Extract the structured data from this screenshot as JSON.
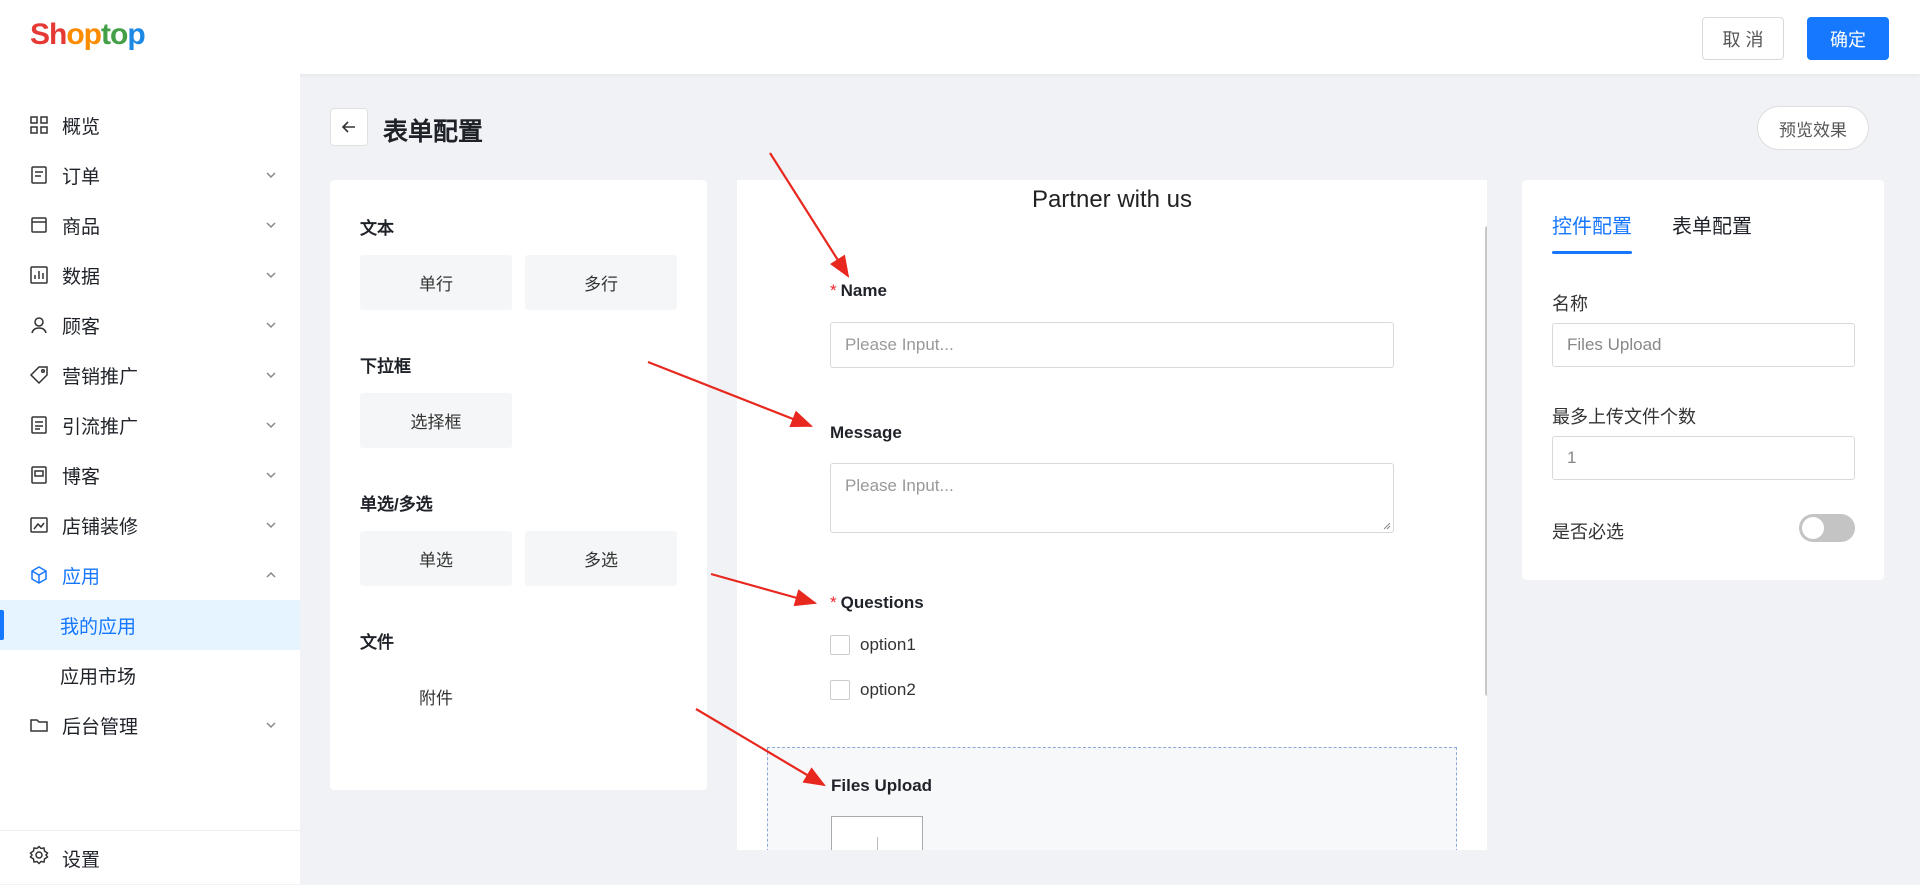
{
  "header": {
    "logo": [
      "Sh",
      "op",
      "to",
      "p"
    ],
    "cancel_label": "取 消",
    "ok_label": "确定"
  },
  "sidebar": {
    "items": [
      {
        "label": "概览",
        "icon": "dashboard-icon"
      },
      {
        "label": "订单",
        "icon": "order-icon"
      },
      {
        "label": "商品",
        "icon": "product-icon"
      },
      {
        "label": "数据",
        "icon": "chart-icon"
      },
      {
        "label": "顾客",
        "icon": "user-icon"
      },
      {
        "label": "营销推广",
        "icon": "tag-icon"
      },
      {
        "label": "引流推广",
        "icon": "document-icon"
      },
      {
        "label": "博客",
        "icon": "blog-icon"
      },
      {
        "label": "店铺装修",
        "icon": "store-icon"
      },
      {
        "label": "应用",
        "icon": "cube-icon"
      }
    ],
    "sub_items": [
      "我的应用",
      "应用市场"
    ],
    "admin": {
      "label": "后台管理",
      "icon": "folder-icon"
    },
    "settings": {
      "label": "设置",
      "icon": "gear-icon"
    }
  },
  "page": {
    "title": "表单配置",
    "preview_label": "预览效果"
  },
  "palette": {
    "groups": [
      {
        "title": "文本",
        "buttons": [
          "单行",
          "多行"
        ]
      },
      {
        "title": "下拉框",
        "buttons": [
          "选择框"
        ]
      },
      {
        "title": "单选/多选",
        "buttons": [
          "单选",
          "多选"
        ]
      },
      {
        "title": "文件",
        "buttons": [
          "附件"
        ]
      }
    ]
  },
  "form": {
    "title": "Partner with us",
    "name_label": "Name",
    "name_placeholder": "Please Input...",
    "message_label": "Message",
    "message_placeholder": "Please Input...",
    "questions_label": "Questions",
    "options": [
      "option1",
      "option2"
    ],
    "files_label": "Files Upload",
    "required_mark": "*"
  },
  "config": {
    "tabs": [
      "控件配置",
      "表单配置"
    ],
    "name_label": "名称",
    "name_value": "Files Upload",
    "max_label": "最多上传文件个数",
    "max_value": "1",
    "required_label": "是否必选",
    "required_on": false
  },
  "colors": {
    "accent": "#1677ff",
    "annotation": "#e8281e",
    "required": "#f5222d"
  }
}
